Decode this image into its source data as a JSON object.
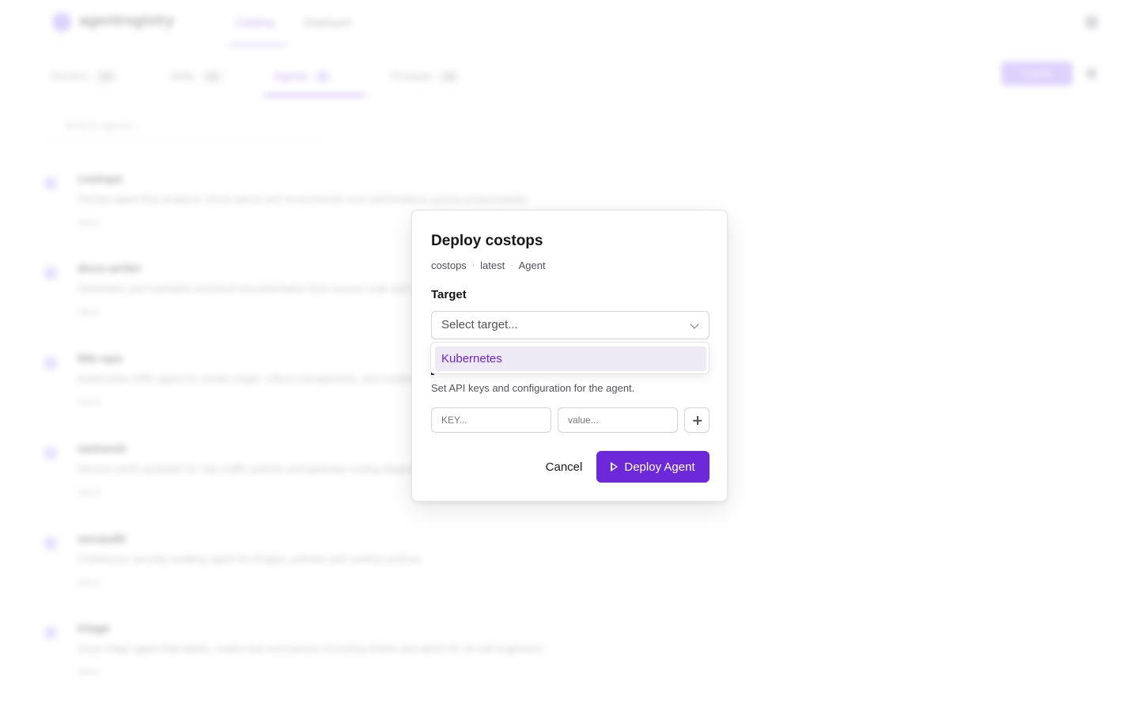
{
  "background": {
    "brand": "agentregistry",
    "nav_tabs": [
      "Catalog",
      "Deployed"
    ],
    "sub_tabs": [
      {
        "label": "Servers",
        "count": "23"
      },
      {
        "label": "Skills",
        "count": "12"
      },
      {
        "label": "Agents",
        "count": "6"
      },
      {
        "label": "Prompts",
        "count": "14"
      }
    ],
    "create_label": "Create",
    "search_placeholder": "Search agents...",
    "items": [
      {
        "title": "costops",
        "desc": "FinOps agent that analyzes cloud spend and recommends cost optimizations across environments.",
        "meta": "latest"
      },
      {
        "title": "docs-writer",
        "desc": "Generates and maintains technical documentation from source code and design notes.",
        "meta": "latest"
      },
      {
        "title": "k8s-ops",
        "desc": "Kubernetes SRE agent for cluster triage, rollout management, and incident response workflows.",
        "meta": "latest"
      },
      {
        "title": "netmesh",
        "desc": "Service mesh assistant for Istio traffic policies and gateway routing diagnostics.",
        "meta": "latest"
      },
      {
        "title": "secaudit",
        "desc": "Continuous security auditing agent for images, policies and runtime posture.",
        "meta": "latest"
      },
      {
        "title": "triage",
        "desc": "Issue triage agent that labels, routes and summarizes incoming tickets and alerts for on-call engineers.",
        "meta": "latest"
      }
    ]
  },
  "dialog": {
    "title": "Deploy costops",
    "meta": [
      "costops",
      "latest",
      "Agent"
    ],
    "target_label": "Target",
    "target_placeholder": "Select target...",
    "dropdown_options": [
      "Kubernetes"
    ],
    "env_description": "Set API keys and configuration for the agent.",
    "key_placeholder": "KEY...",
    "value_placeholder": "value...",
    "cancel_label": "Cancel",
    "deploy_label": "Deploy Agent"
  },
  "colors": {
    "accent": "#6d28d9",
    "option_highlight": "#ede9f5"
  }
}
